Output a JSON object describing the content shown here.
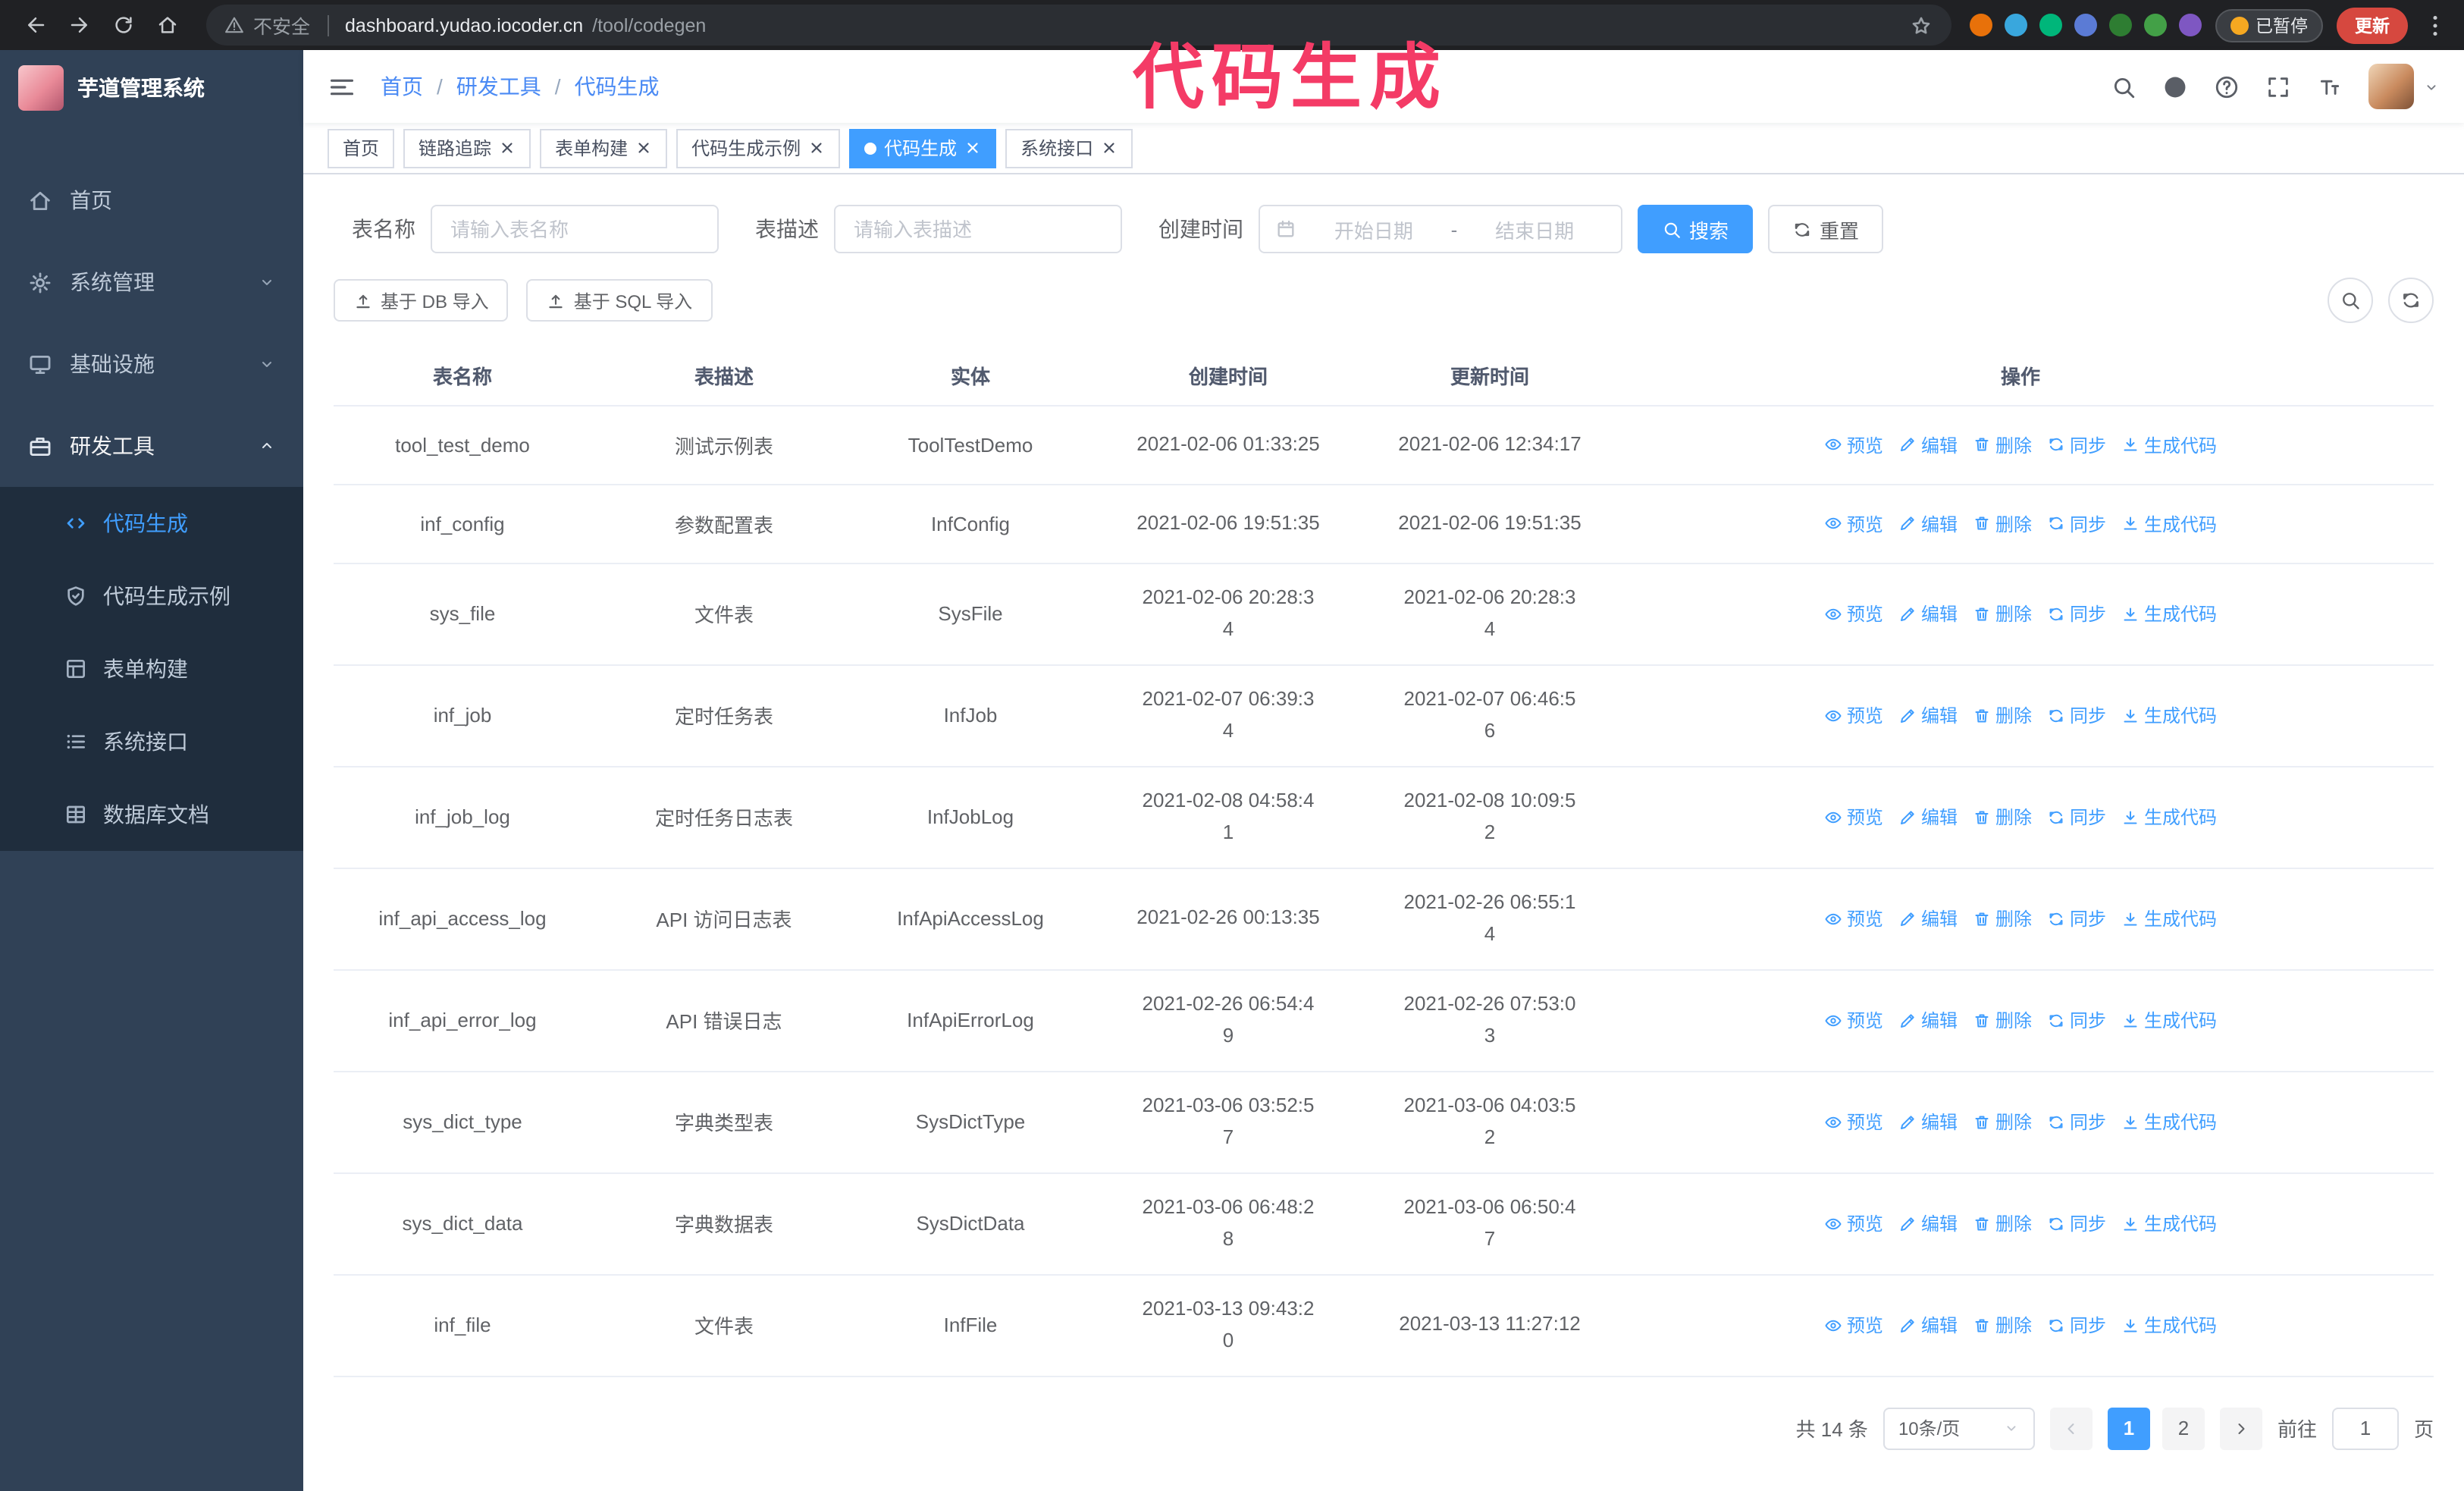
{
  "colors": {
    "primary": "#409eff",
    "sidebar_bg": "#304156",
    "submenu_bg": "#1f2d3d",
    "update_button": "#d6483f",
    "annotation": "#f43b66"
  },
  "annotation": {
    "text": "代码生成"
  },
  "browser": {
    "insecure_label": "不安全",
    "url_host": "dashboard.yudao.iocoder.cn",
    "url_path": "/tool/codegen",
    "paused_badge": "已暂停",
    "update_label": "更新",
    "extension_colors": [
      "#e8710a",
      "#39a7dd",
      "#00b67a",
      "#5b7bd5",
      "#2e7d32",
      "#43a047",
      "#7e57c2"
    ]
  },
  "sidebar": {
    "logo_title": "芋道管理系统",
    "menu": [
      {
        "id": "home",
        "label": "首页",
        "icon": "home-icon",
        "expandable": false,
        "expanded": false
      },
      {
        "id": "system",
        "label": "系统管理",
        "icon": "gear-icon",
        "expandable": true,
        "expanded": false
      },
      {
        "id": "infra",
        "label": "基础设施",
        "icon": "monitor-icon",
        "expandable": true,
        "expanded": false
      },
      {
        "id": "dev-tools",
        "label": "研发工具",
        "icon": "tools-icon",
        "expandable": true,
        "expanded": true,
        "children": [
          {
            "id": "codegen",
            "label": "代码生成",
            "icon": "code-icon",
            "active": true
          },
          {
            "id": "codegen-demo",
            "label": "代码生成示例",
            "icon": "badge-icon",
            "active": false
          },
          {
            "id": "form-build",
            "label": "表单构建",
            "icon": "form-icon",
            "active": false
          },
          {
            "id": "system-api",
            "label": "系统接口",
            "icon": "api-icon",
            "active": false
          },
          {
            "id": "db-doc",
            "label": "数据库文档",
            "icon": "database-icon",
            "active": false
          }
        ]
      }
    ]
  },
  "header": {
    "breadcrumb": [
      "首页",
      "研发工具",
      "代码生成"
    ],
    "breadcrumb_separator": "/"
  },
  "tabs": [
    {
      "id": "home",
      "label": "首页",
      "closable": false,
      "active": false
    },
    {
      "id": "trace",
      "label": "链路追踪",
      "closable": true,
      "active": false
    },
    {
      "id": "form-build",
      "label": "表单构建",
      "closable": true,
      "active": false
    },
    {
      "id": "codegen-demo",
      "label": "代码生成示例",
      "closable": true,
      "active": false
    },
    {
      "id": "codegen",
      "label": "代码生成",
      "closable": true,
      "active": true
    },
    {
      "id": "system-api",
      "label": "系统接口",
      "closable": true,
      "active": false
    }
  ],
  "filters": {
    "table_name_label": "表名称",
    "table_name_placeholder": "请输入表名称",
    "table_desc_label": "表描述",
    "table_desc_placeholder": "请输入表描述",
    "create_time_label": "创建时间",
    "date_start_placeholder": "开始日期",
    "date_separator": "-",
    "date_end_placeholder": "结束日期",
    "search_label": "搜索",
    "reset_label": "重置"
  },
  "toolbar": {
    "import_db_label": "基于 DB 导入",
    "import_sql_label": "基于 SQL 导入"
  },
  "table": {
    "columns": [
      "表名称",
      "表描述",
      "实体",
      "创建时间",
      "更新时间",
      "操作"
    ],
    "actions": [
      "预览",
      "编辑",
      "删除",
      "同步",
      "生成代码"
    ],
    "action_icons": [
      "eye-icon",
      "edit-icon",
      "delete-icon",
      "sync-icon",
      "download-icon"
    ],
    "rows": [
      {
        "name": "tool_test_demo",
        "desc": "测试示例表",
        "entity": "ToolTestDemo",
        "created": "2021-02-06 01:33:25",
        "updated": "2021-02-06 12:34:17",
        "created_two_line": false,
        "updated_two_line": false
      },
      {
        "name": "inf_config",
        "desc": "参数配置表",
        "entity": "InfConfig",
        "created": "2021-02-06 19:51:35",
        "updated": "2021-02-06 19:51:35",
        "created_two_line": false,
        "updated_two_line": false
      },
      {
        "name": "sys_file",
        "desc": "文件表",
        "entity": "SysFile",
        "created": "2021-02-06 20:28:34",
        "updated": "2021-02-06 20:28:34",
        "created_two_line": true,
        "updated_two_line": true
      },
      {
        "name": "inf_job",
        "desc": "定时任务表",
        "entity": "InfJob",
        "created": "2021-02-07 06:39:34",
        "updated": "2021-02-07 06:46:56",
        "created_two_line": true,
        "updated_two_line": true
      },
      {
        "name": "inf_job_log",
        "desc": "定时任务日志表",
        "entity": "InfJobLog",
        "created": "2021-02-08 04:58:41",
        "updated": "2021-02-08 10:09:52",
        "created_two_line": true,
        "updated_two_line": true
      },
      {
        "name": "inf_api_access_log",
        "desc": "API 访问日志表",
        "entity": "InfApiAccessLog",
        "created": "2021-02-26 00:13:35",
        "updated": "2021-02-26 06:55:14",
        "created_two_line": false,
        "updated_two_line": true
      },
      {
        "name": "inf_api_error_log",
        "desc": "API 错误日志",
        "entity": "InfApiErrorLog",
        "created": "2021-02-26 06:54:49",
        "updated": "2021-02-26 07:53:03",
        "created_two_line": true,
        "updated_two_line": true
      },
      {
        "name": "sys_dict_type",
        "desc": "字典类型表",
        "entity": "SysDictType",
        "created": "2021-03-06 03:52:57",
        "updated": "2021-03-06 04:03:52",
        "created_two_line": true,
        "updated_two_line": true
      },
      {
        "name": "sys_dict_data",
        "desc": "字典数据表",
        "entity": "SysDictData",
        "created": "2021-03-06 06:48:28",
        "updated": "2021-03-06 06:50:47",
        "created_two_line": true,
        "updated_two_line": true
      },
      {
        "name": "inf_file",
        "desc": "文件表",
        "entity": "InfFile",
        "created": "2021-03-13 09:43:20",
        "updated": "2021-03-13 11:27:12",
        "created_two_line": true,
        "updated_two_line": false
      }
    ]
  },
  "pagination": {
    "total_label": "共 14 条",
    "page_size": "10条/页",
    "pages": [
      "1",
      "2"
    ],
    "active_page": "1",
    "goto_label": "前往",
    "goto_value": "1",
    "goto_suffix": "页"
  }
}
